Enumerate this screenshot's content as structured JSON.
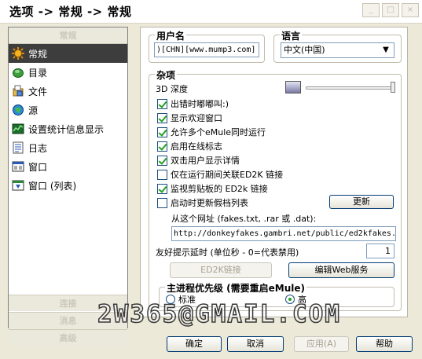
{
  "window": {
    "title": "选项 -> 常规 -> 常规"
  },
  "sidebar": {
    "header": "常规",
    "items": [
      {
        "label": "常规",
        "icon": "gear-sun-icon",
        "selected": true
      },
      {
        "label": "目录",
        "icon": "folder-icon"
      },
      {
        "label": "文件",
        "icon": "file-icon"
      },
      {
        "label": "源",
        "icon": "source-icon"
      },
      {
        "label": "设置统计信息显示",
        "icon": "statistics-icon"
      },
      {
        "label": "日志",
        "icon": "log-icon"
      },
      {
        "label": "窗口",
        "icon": "window-icon"
      },
      {
        "label": "窗口 (列表)",
        "icon": "window-list-icon"
      }
    ],
    "footers": [
      "连接",
      "消息",
      "高级"
    ]
  },
  "username": {
    "legend": "用户名",
    "value": ")[CHN][www.mump3.com]"
  },
  "language": {
    "legend": "语言",
    "selected": "中文(中国)"
  },
  "misc": {
    "legend": "杂项",
    "depth_label": "3D 深度",
    "options": [
      {
        "label": "出错时嘟嘟叫:)",
        "checked": true
      },
      {
        "label": "显示欢迎窗口",
        "checked": true
      },
      {
        "label": "允许多个eMule同时运行",
        "checked": true
      },
      {
        "label": "启用在线标志",
        "checked": true
      },
      {
        "label": "双击用户显示详情",
        "checked": true
      },
      {
        "label": "仅在运行期间关联ED2K 链接",
        "checked": false
      },
      {
        "label": "监视剪贴板的 ED2k 链接",
        "checked": true
      },
      {
        "label": "启动时更新假档列表",
        "checked": false
      }
    ],
    "update_button": "更新",
    "from_url_label": "从这个网址 (fakes.txt, .rar 或 .dat):",
    "url_value": "http://donkeyfakes.gambri.net/public/ed2kfakes.",
    "tooltip_delay_label": "友好提示延时 (单位秒 - 0=代表禁用)",
    "tooltip_delay_value": "1",
    "ed2k_button": "ED2K链接",
    "edit_web_button": "编辑Web服务"
  },
  "priority": {
    "legend": "主进程优先级 (需要重启eMule)",
    "normal_label": "标准",
    "high_label": "高",
    "selected": "high"
  },
  "watermark": "2W365@GMAIL.COM",
  "buttons": {
    "ok": "确定",
    "cancel": "取消",
    "apply": "应用(A)",
    "help": "帮助"
  },
  "colors": {
    "selected_bg": "#3d3d3d",
    "checkmark": "#21a121",
    "dialog_bg": "#ece9d8"
  }
}
